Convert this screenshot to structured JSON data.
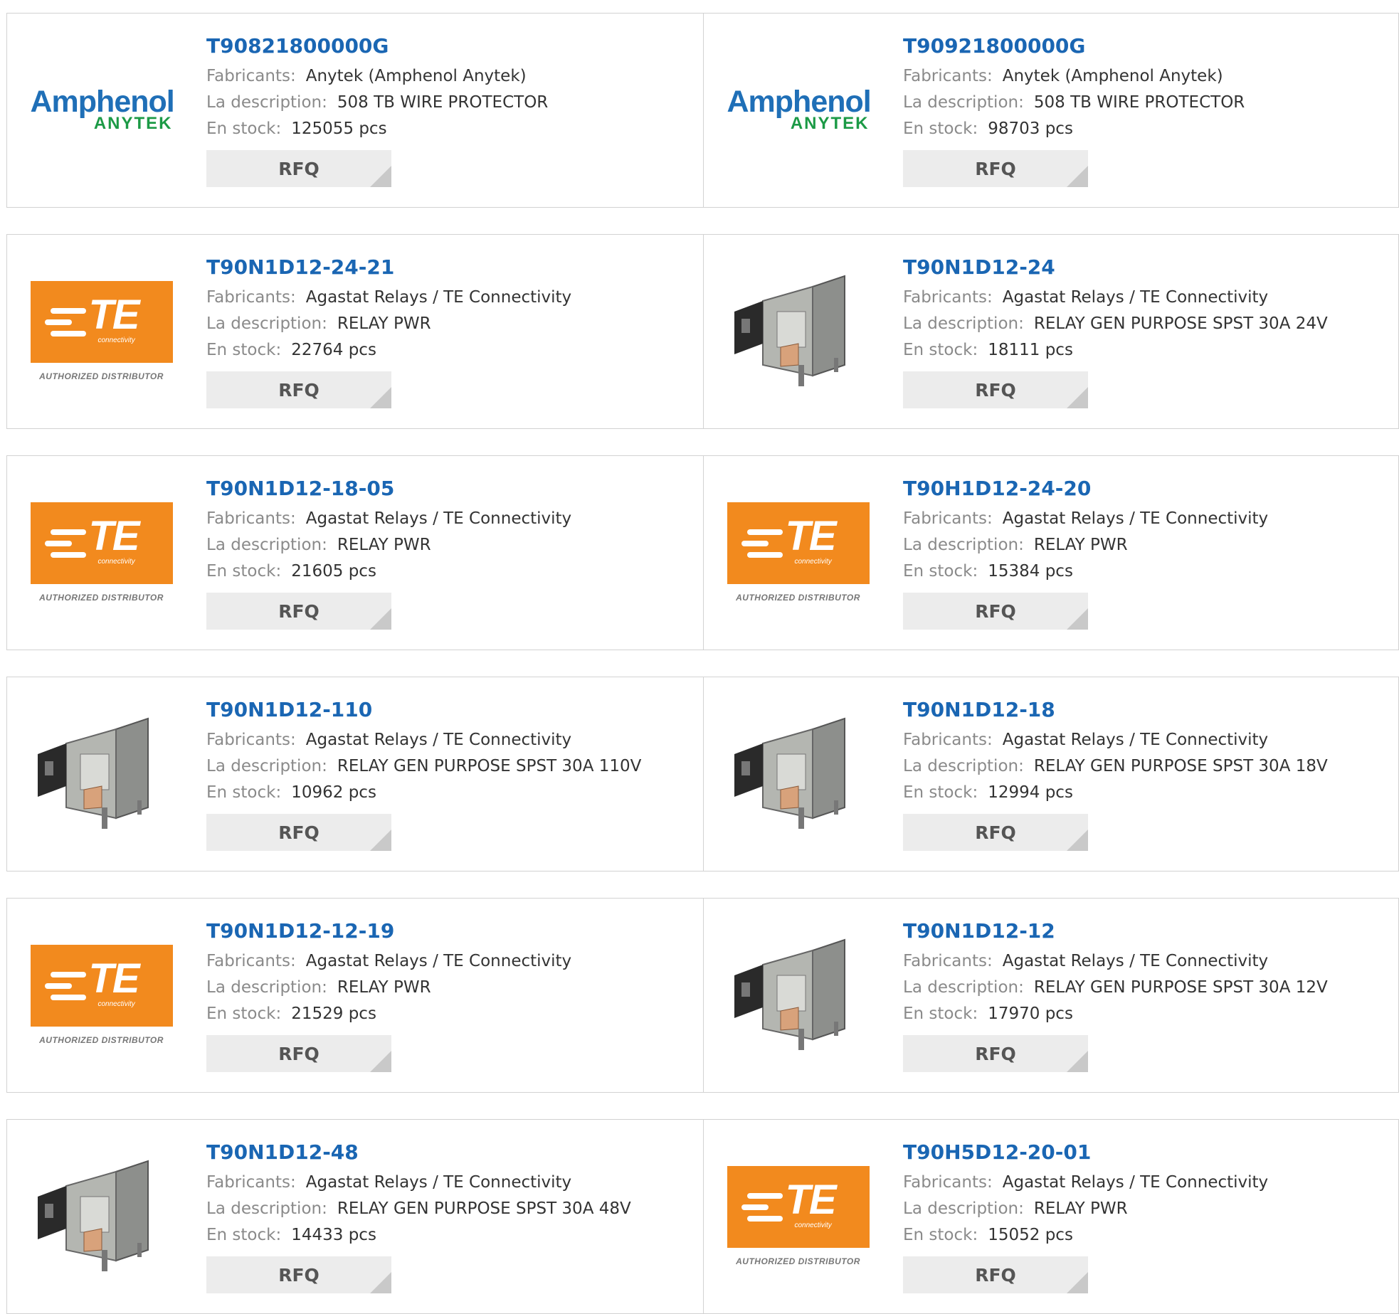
{
  "labels": {
    "manufacturer": "Fabricants:",
    "description": "La description:",
    "stock": "En stock:",
    "rfq": "RFQ"
  },
  "logos": {
    "amphenol_line1": "Amphenol",
    "amphenol_line2": "ANYTEK",
    "te_letters": "TE",
    "te_sub": "connectivity",
    "te_authorized": "AUTHORIZED DISTRIBUTOR"
  },
  "products": [
    {
      "part": "T90821800000G",
      "manufacturer": "Anytek (Amphenol Anytek)",
      "description": "508 TB WIRE PROTECTOR",
      "stock": "125055 pcs",
      "image": "amphenol"
    },
    {
      "part": "T90921800000G",
      "manufacturer": "Anytek (Amphenol Anytek)",
      "description": "508 TB WIRE PROTECTOR",
      "stock": "98703 pcs",
      "image": "amphenol"
    },
    {
      "part": "T90N1D12-24-21",
      "manufacturer": "Agastat Relays / TE Connectivity",
      "description": "RELAY PWR",
      "stock": "22764 pcs",
      "image": "te"
    },
    {
      "part": "T90N1D12-24",
      "manufacturer": "Agastat Relays / TE Connectivity",
      "description": "RELAY GEN PURPOSE SPST 30A 24V",
      "stock": "18111 pcs",
      "image": "relay"
    },
    {
      "part": "T90N1D12-18-05",
      "manufacturer": "Agastat Relays / TE Connectivity",
      "description": "RELAY PWR",
      "stock": "21605 pcs",
      "image": "te"
    },
    {
      "part": "T90H1D12-24-20",
      "manufacturer": "Agastat Relays / TE Connectivity",
      "description": "RELAY PWR",
      "stock": "15384 pcs",
      "image": "te"
    },
    {
      "part": "T90N1D12-110",
      "manufacturer": "Agastat Relays / TE Connectivity",
      "description": "RELAY GEN PURPOSE SPST 30A 110V",
      "stock": "10962 pcs",
      "image": "relay"
    },
    {
      "part": "T90N1D12-18",
      "manufacturer": "Agastat Relays / TE Connectivity",
      "description": "RELAY GEN PURPOSE SPST 30A 18V",
      "stock": "12994 pcs",
      "image": "relay"
    },
    {
      "part": "T90N1D12-12-19",
      "manufacturer": "Agastat Relays / TE Connectivity",
      "description": "RELAY PWR",
      "stock": "21529 pcs",
      "image": "te"
    },
    {
      "part": "T90N1D12-12",
      "manufacturer": "Agastat Relays / TE Connectivity",
      "description": "RELAY GEN PURPOSE SPST 30A 12V",
      "stock": "17970 pcs",
      "image": "relay"
    },
    {
      "part": "T90N1D12-48",
      "manufacturer": "Agastat Relays / TE Connectivity",
      "description": "RELAY GEN PURPOSE SPST 30A 48V",
      "stock": "14433 pcs",
      "image": "relay"
    },
    {
      "part": "T90H5D12-20-01",
      "manufacturer": "Agastat Relays / TE Connectivity",
      "description": "RELAY PWR",
      "stock": "15052 pcs",
      "image": "te"
    }
  ]
}
